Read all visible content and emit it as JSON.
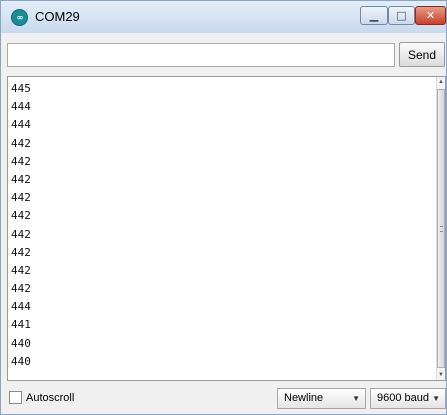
{
  "window": {
    "title": "COM29"
  },
  "titlebar": {
    "app_icon": "arduino-icon",
    "min_glyph": "▁",
    "max_glyph": "□",
    "close_glyph": "✕"
  },
  "send": {
    "input_value": "",
    "button_label": "Send"
  },
  "output": {
    "lines": [
      "445",
      "444",
      "444",
      "442",
      "442",
      "442",
      "442",
      "442",
      "442",
      "442",
      "442",
      "442",
      "444",
      "441",
      "440",
      "440"
    ]
  },
  "footer": {
    "autoscroll_label": "Autoscroll",
    "autoscroll_checked": false,
    "line_ending": "Newline",
    "baud_rate": "9600 baud"
  },
  "colors": {
    "titlebar": "#c9daee",
    "close": "#c7402a",
    "icon": "#1b8d96"
  }
}
